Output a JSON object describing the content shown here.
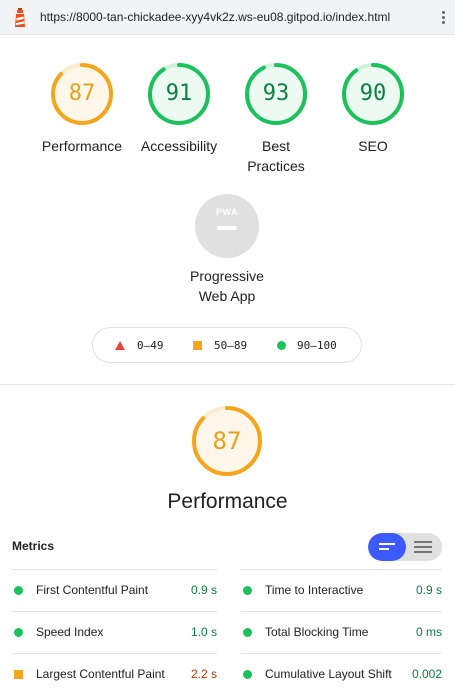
{
  "address_bar": {
    "url": "https://8000-tan-chickadee-xyy4vk2z.ws-eu08.gitpod.io/index.html"
  },
  "colors": {
    "pass": "#1bc15b",
    "average": "#f4a51c",
    "fail": "#e8453c",
    "toggle_active": "#3d5afe"
  },
  "categories": [
    {
      "label": "Performance",
      "score": "87",
      "rating": "average"
    },
    {
      "label": "Accessibility",
      "score": "91",
      "rating": "pass"
    },
    {
      "label": "Best Practices",
      "score": "93",
      "rating": "pass"
    },
    {
      "label": "SEO",
      "score": "90",
      "rating": "pass"
    }
  ],
  "pwa": {
    "badge": "PWA",
    "label": "Progressive Web App"
  },
  "legend": {
    "fail": "0–49",
    "average": "50–89",
    "pass": "90–100"
  },
  "performance": {
    "score": "87",
    "title": "Performance",
    "metrics_heading": "Metrics",
    "metrics": [
      {
        "label": "First Contentful Paint",
        "value": "0.9 s",
        "rating": "pass"
      },
      {
        "label": "Time to Interactive",
        "value": "0.9 s",
        "rating": "pass"
      },
      {
        "label": "Speed Index",
        "value": "1.0 s",
        "rating": "pass"
      },
      {
        "label": "Total Blocking Time",
        "value": "0 ms",
        "rating": "pass"
      },
      {
        "label": "Largest Contentful Paint",
        "value": "2.2 s",
        "rating": "average"
      },
      {
        "label": "Cumulative Layout Shift",
        "value": "0.002",
        "rating": "pass"
      }
    ]
  }
}
